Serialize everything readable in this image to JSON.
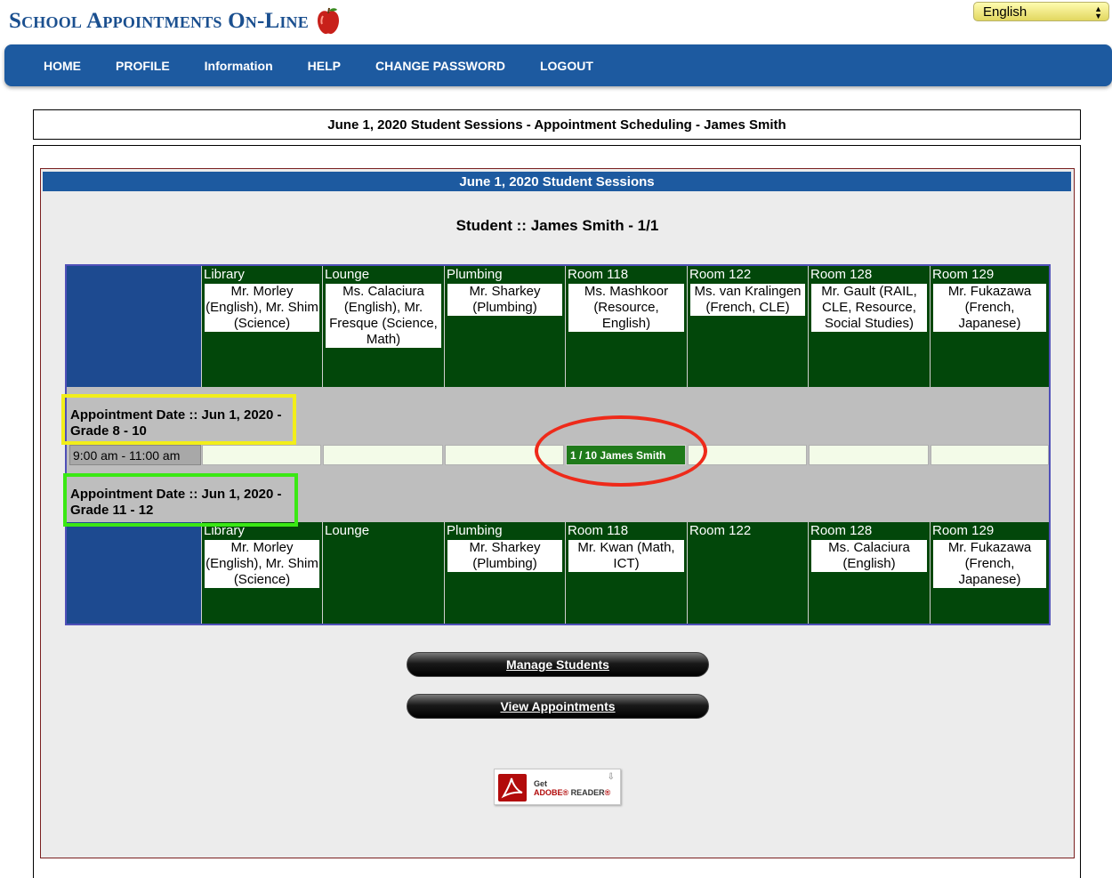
{
  "header": {
    "logo_text": "School Appointments On-Line",
    "language": "English"
  },
  "nav": {
    "items": [
      "HOME",
      "PROFILE",
      "Information",
      "HELP",
      "CHANGE PASSWORD",
      "LOGOUT"
    ]
  },
  "page_title": "June 1, 2020 Student Sessions - Appointment Scheduling - James Smith",
  "panel": {
    "heading": "June 1, 2020 Student Sessions",
    "student_line": "Student :: James Smith - 1/1"
  },
  "session1": {
    "rooms": [
      {
        "name": "Library",
        "teacher": "Mr. Morley (English), Mr. Shim (Science)"
      },
      {
        "name": "Lounge",
        "teacher": "Ms. Calaciura (English), Mr. Fresque (Science, Math)"
      },
      {
        "name": "Plumbing",
        "teacher": "Mr. Sharkey (Plumbing)"
      },
      {
        "name": "Room 118",
        "teacher": "Ms. Mashkoor (Resource, English)"
      },
      {
        "name": "Room 122",
        "teacher": "Ms. van Kralingen (French, CLE)"
      },
      {
        "name": "Room 128",
        "teacher": "Mr. Gault (RAIL, CLE, Resource, Social Studies)"
      },
      {
        "name": "Room 129",
        "teacher": "Mr. Fukazawa (French, Japanese)"
      }
    ],
    "appointment_label": "Appointment Date :: Jun 1, 2020 - Grade 8 - 10",
    "time": "9:00 am - 11:00 am",
    "booked_slot": "1 / 10  James Smith"
  },
  "session2": {
    "appointment_label": "Appointment Date :: Jun 1, 2020 - Grade 11 - 12",
    "rooms": [
      {
        "name": "Library",
        "teacher": "Mr. Morley (English), Mr. Shim (Science)"
      },
      {
        "name": "Lounge",
        "teacher": ""
      },
      {
        "name": "Plumbing",
        "teacher": "Mr. Sharkey (Plumbing)"
      },
      {
        "name": "Room 118",
        "teacher": "Mr. Kwan (Math, ICT)"
      },
      {
        "name": "Room 122",
        "teacher": ""
      },
      {
        "name": "Room 128",
        "teacher": "Ms. Calaciura (English)"
      },
      {
        "name": "Room 129",
        "teacher": "Mr. Fukazawa (French, Japanese)"
      }
    ]
  },
  "buttons": {
    "manage_students": "Manage Students",
    "view_appointments": "View Appointments"
  },
  "adobe": {
    "get": "Get",
    "brand": "ADOBE",
    "product": "READER"
  },
  "colors": {
    "nav_blue": "#1d5aa0",
    "room_green": "#02470a",
    "booked_green": "#1f7a1a",
    "highlight_yellow": "#f2ee1a",
    "highlight_green": "#3ae814",
    "highlight_red": "#ee2a1a"
  }
}
